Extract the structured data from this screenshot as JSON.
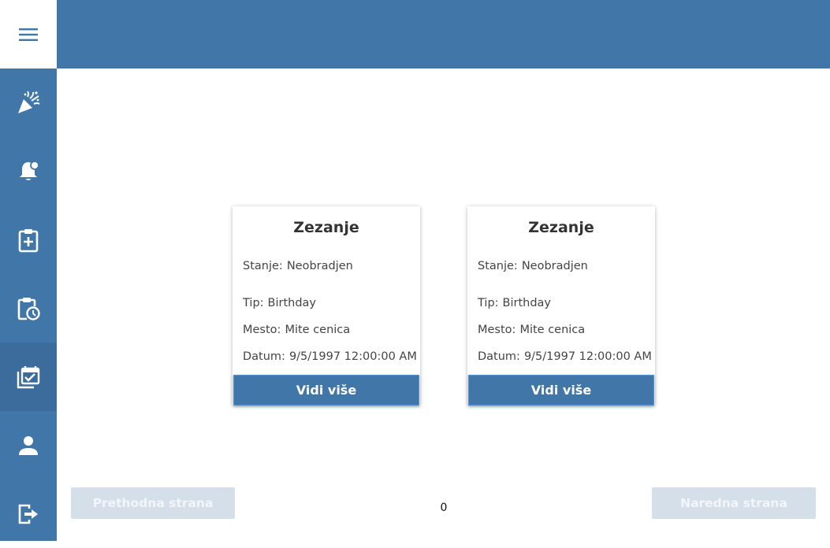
{
  "nav": {
    "menu_icon": "hamburger-menu-icon",
    "items": [
      {
        "icon": "party-popper-icon",
        "active": false
      },
      {
        "icon": "bell-notification-icon",
        "active": false
      },
      {
        "icon": "clipboard-add-icon",
        "active": false
      },
      {
        "icon": "clipboard-clock-icon",
        "active": false
      },
      {
        "icon": "calendar-check-icon",
        "active": true
      },
      {
        "icon": "user-icon",
        "active": false
      },
      {
        "icon": "logout-icon",
        "active": false
      }
    ]
  },
  "cards": [
    {
      "title": "Zezanje",
      "state_label": "Stanje:",
      "state_value": "Neobradjen",
      "type_label": "Tip:",
      "type_value": "Birthday",
      "place_label": "Mesto:",
      "place_value": "Mite cenica",
      "date_label": "Datum:",
      "date_value": "9/5/1997 12:00:00 AM",
      "button": "Vidi više"
    },
    {
      "title": "Zezanje",
      "state_label": "Stanje:",
      "state_value": "Neobradjen",
      "type_label": "Tip:",
      "type_value": "Birthday",
      "place_label": "Mesto:",
      "place_value": "Mite cenica",
      "date_label": "Datum:",
      "date_value": "9/5/1997 12:00:00 AM",
      "button": "Vidi više"
    }
  ],
  "pagination": {
    "prev_label": "Prethodna strana",
    "next_label": "Naredna strana",
    "page": "0"
  },
  "colors": {
    "primary": "#4176a9",
    "active_nav": "#3b6c9b",
    "disabled_button": "#d4dfea"
  }
}
